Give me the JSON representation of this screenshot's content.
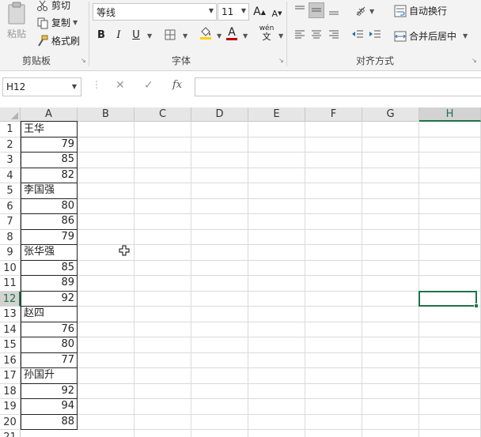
{
  "clipboard": {
    "cut_label": "剪切",
    "copy_label": "复制",
    "format_painter_label": "格式刷",
    "paste_label": "粘贴",
    "group_label": "剪贴板"
  },
  "font": {
    "font_name": "等线",
    "font_size": "11",
    "grow_label": "A",
    "shrink_label": "A",
    "bold_label": "B",
    "italic_label": "I",
    "underline_label": "U",
    "phonetic_label": "wén",
    "group_label": "字体"
  },
  "alignment": {
    "wrap_text_label": "自动换行",
    "merge_center_label": "合并后居中",
    "group_label": "对齐方式"
  },
  "formula_bar": {
    "name_box": "H12",
    "fx_label": "fx",
    "formula": ""
  },
  "columns": [
    "A",
    "B",
    "C",
    "D",
    "E",
    "F",
    "G",
    "H"
  ],
  "selected_column": "H",
  "selected_row": "12",
  "rows": [
    {
      "num": "1",
      "a": "王华",
      "type": "txt"
    },
    {
      "num": "2",
      "a": "79",
      "type": "num"
    },
    {
      "num": "3",
      "a": "85",
      "type": "num"
    },
    {
      "num": "4",
      "a": "82",
      "type": "num"
    },
    {
      "num": "5",
      "a": "李国强",
      "type": "txt"
    },
    {
      "num": "6",
      "a": "80",
      "type": "num"
    },
    {
      "num": "7",
      "a": "86",
      "type": "num"
    },
    {
      "num": "8",
      "a": "79",
      "type": "num"
    },
    {
      "num": "9",
      "a": "张华强",
      "type": "txt"
    },
    {
      "num": "10",
      "a": "85",
      "type": "num"
    },
    {
      "num": "11",
      "a": "89",
      "type": "num"
    },
    {
      "num": "12",
      "a": "92",
      "type": "num"
    },
    {
      "num": "13",
      "a": "赵四",
      "type": "txt"
    },
    {
      "num": "14",
      "a": "76",
      "type": "num"
    },
    {
      "num": "15",
      "a": "80",
      "type": "num"
    },
    {
      "num": "16",
      "a": "77",
      "type": "num"
    },
    {
      "num": "17",
      "a": "孙国升",
      "type": "txt"
    },
    {
      "num": "18",
      "a": "92",
      "type": "num"
    },
    {
      "num": "19",
      "a": "94",
      "type": "num"
    },
    {
      "num": "20",
      "a": "88",
      "type": "num"
    },
    {
      "num": "21",
      "a": "",
      "type": "num"
    }
  ],
  "colors": {
    "accent": "#217346",
    "font_color_bar": "#c00000",
    "ribbon_bg": "#f3f3f3"
  }
}
